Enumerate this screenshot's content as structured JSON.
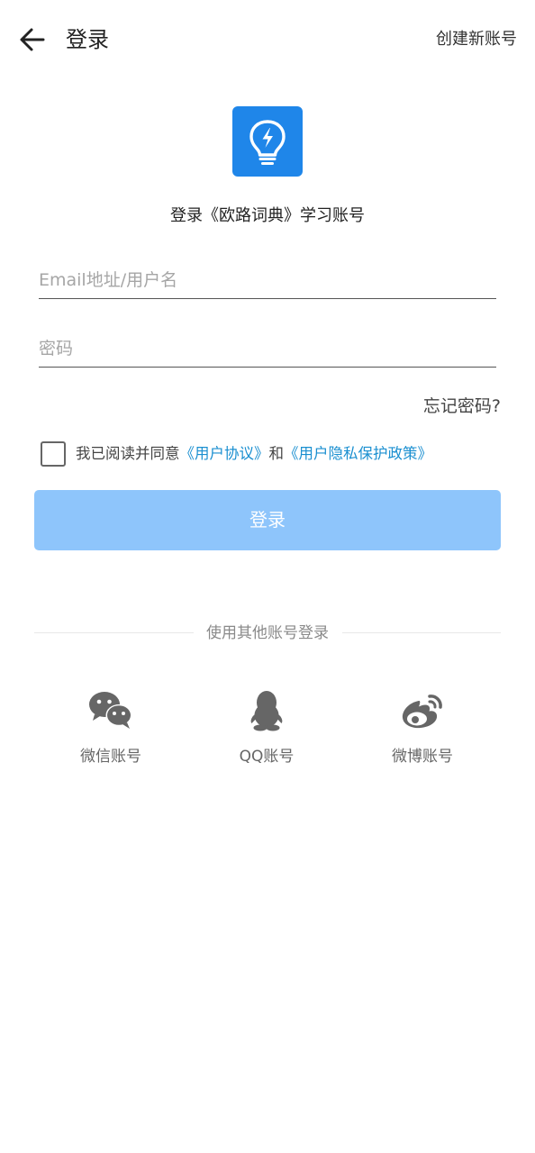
{
  "appbar": {
    "title": "登录",
    "create_account": "创建新账号"
  },
  "logo": {
    "icon": "lightbulb-bolt-icon",
    "color": "#1f86e9"
  },
  "subtitle": "登录《欧路词典》学习账号",
  "form": {
    "email_placeholder": "Email地址/用户名",
    "email_value": "",
    "password_placeholder": "密码",
    "password_value": ""
  },
  "forgot_password": "忘记密码?",
  "agreement": {
    "checked": false,
    "prefix": "我已阅读并同意",
    "user_agreement": "《用户协议》",
    "and": "和",
    "privacy_policy": "《用户隐私保护政策》",
    "link_color": "#1a8fd0"
  },
  "login_button": {
    "label": "登录",
    "color": "#8ec5fb"
  },
  "other_login": {
    "divider": "使用其他账号登录",
    "providers": [
      {
        "label": "微信账号",
        "icon": "wechat-icon"
      },
      {
        "label": "QQ账号",
        "icon": "qq-icon"
      },
      {
        "label": "微博账号",
        "icon": "weibo-icon"
      }
    ]
  }
}
